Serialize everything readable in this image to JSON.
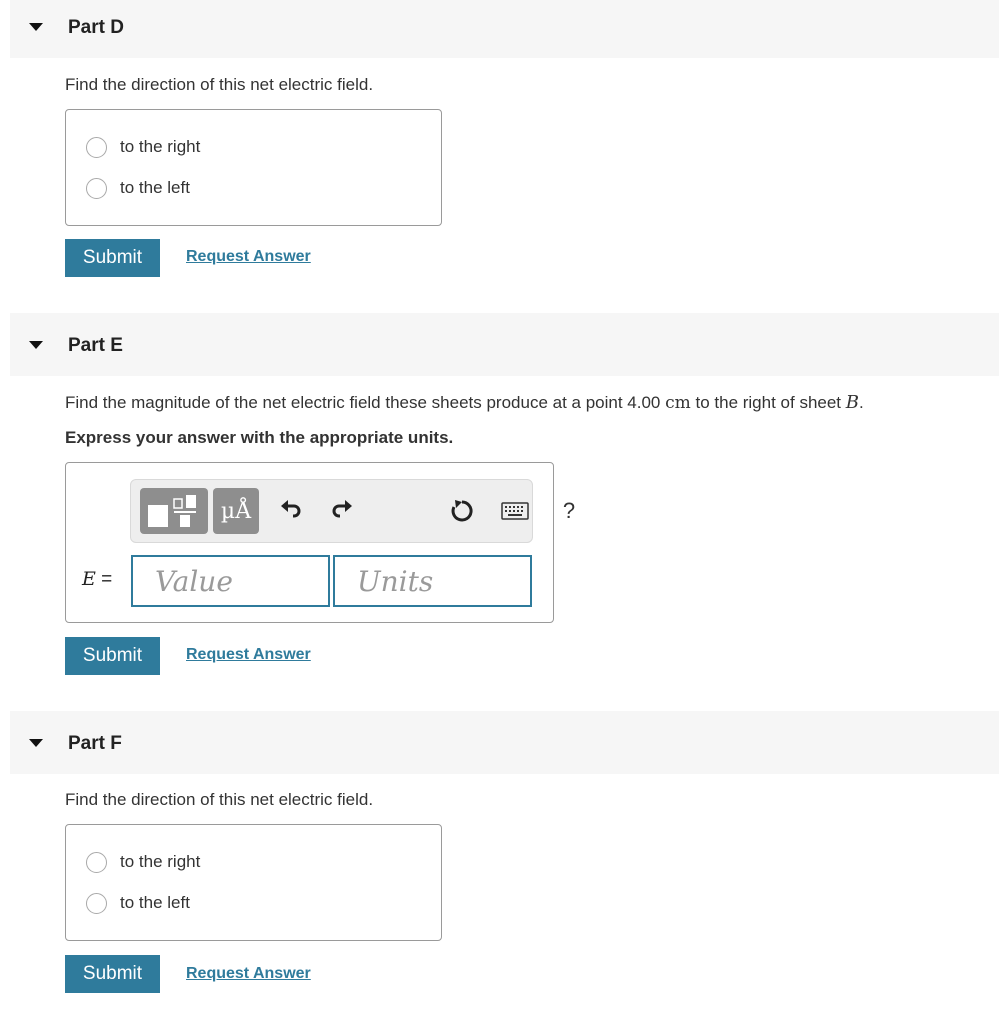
{
  "parts": {
    "d": {
      "title": "Part D",
      "prompt": "Find the direction of this net electric field.",
      "choices": [
        "to the right",
        "to the left"
      ],
      "submit_label": "Submit",
      "request_label": "Request Answer"
    },
    "e": {
      "title": "Part E",
      "prompt_before": "Find the magnitude of the net electric field these sheets produce at a point 4.00 ",
      "prompt_unit": "cm",
      "prompt_middle": " to the right of sheet ",
      "prompt_var": "B",
      "prompt_end": ".",
      "instruction": "Express your answer with the appropriate units.",
      "toolbar": {
        "mu_label": "µÅ",
        "help_label": "?"
      },
      "variable": "E",
      "equals": " =",
      "value_placeholder": "Value",
      "units_placeholder": "Units",
      "submit_label": "Submit",
      "request_label": "Request Answer"
    },
    "f": {
      "title": "Part F",
      "prompt": "Find the direction of this net electric field.",
      "choices": [
        "to the right",
        "to the left"
      ],
      "submit_label": "Submit",
      "request_label": "Request Answer"
    }
  },
  "colors": {
    "accent": "#2f7b9c",
    "header_bg": "#f6f6f6",
    "toolbar_button": "#8e8e8e"
  }
}
